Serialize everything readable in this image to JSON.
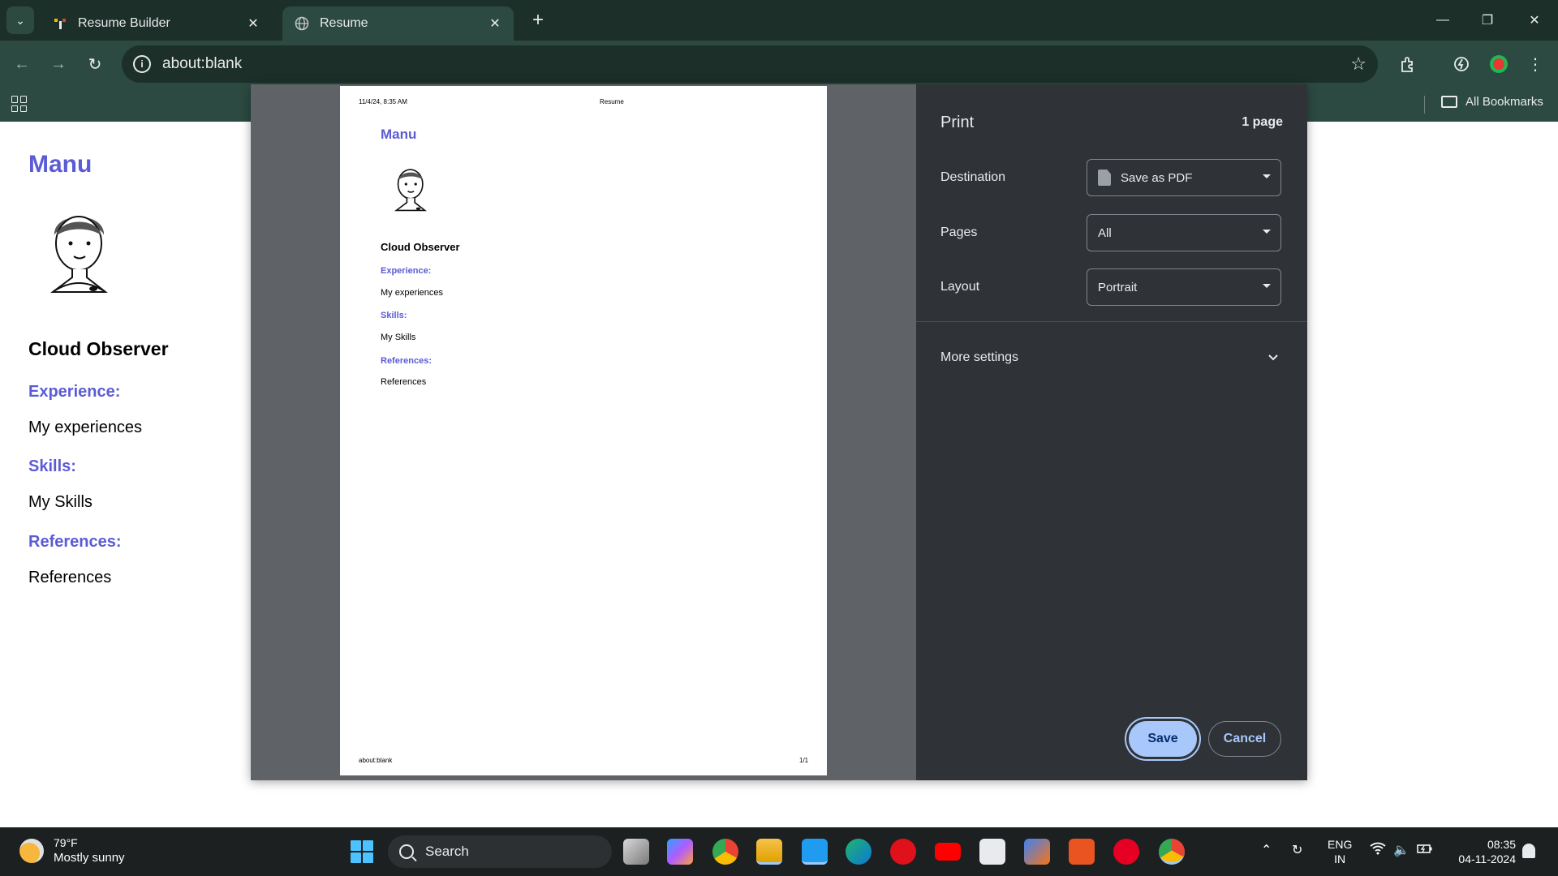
{
  "browser": {
    "tabs": [
      {
        "title": "Resume Builder",
        "active": false
      },
      {
        "title": "Resume",
        "active": true
      }
    ],
    "address": "about:blank",
    "bookmarks_label": "All Bookmarks"
  },
  "page": {
    "name": "Manu",
    "job_title": "Cloud Observer",
    "sections": [
      {
        "heading": "Experience:",
        "text": "My experiences"
      },
      {
        "heading": "Skills:",
        "text": "My Skills"
      },
      {
        "heading": "References:",
        "text": "References"
      }
    ]
  },
  "print_dialog": {
    "title": "Print",
    "page_count": "1 page",
    "destination_label": "Destination",
    "destination_value": "Save as PDF",
    "pages_label": "Pages",
    "pages_value": "All",
    "layout_label": "Layout",
    "layout_value": "Portrait",
    "more_settings": "More settings",
    "save_label": "Save",
    "cancel_label": "Cancel",
    "preview": {
      "header_date": "11/4/24, 8:35 AM",
      "header_title": "Resume",
      "footer_url": "about:blank",
      "footer_page": "1/1"
    }
  },
  "taskbar": {
    "weather_temp": "79°F",
    "weather_condition": "Mostly sunny",
    "search_label": "Search",
    "lang_line1": "ENG",
    "lang_line2": "IN",
    "time": "08:35",
    "date": "04-11-2024",
    "apps": [
      "task-view",
      "copilot",
      "chrome",
      "file-explorer",
      "vscode",
      "edge",
      "opera",
      "youtube",
      "notepad",
      "microsoft-store",
      "ubuntu",
      "pinterest",
      "chrome-active"
    ]
  },
  "colors": {
    "accent": "#5b5bd6",
    "chrome_frame": "#1c2f29",
    "chrome_toolbar": "#2c4a41",
    "dialog_bg": "#2f3337",
    "save_button": "#a8c7fa"
  }
}
